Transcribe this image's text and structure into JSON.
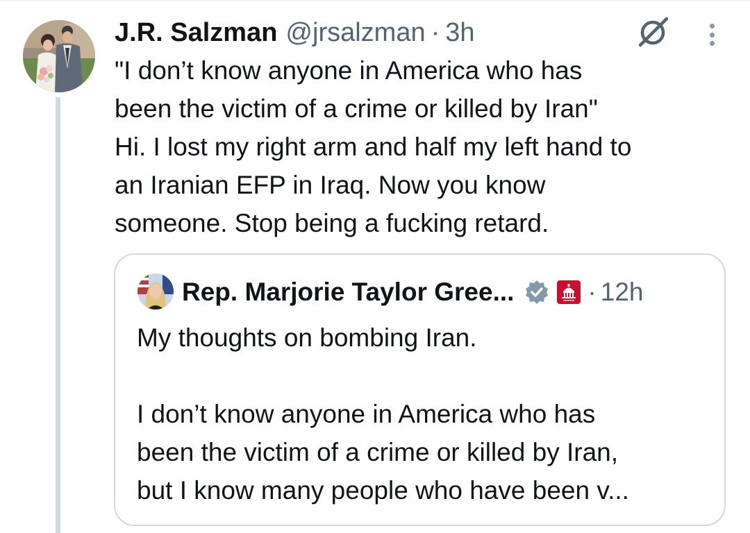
{
  "tweet": {
    "display_name": "J.R. Salzman",
    "handle": "@jrsalzman",
    "separator": "·",
    "time": "3h",
    "text_lines": [
      "\"I don’t know anyone in America who has",
      "been the victim of a crime or killed by Iran\"",
      "Hi. I lost my right arm and half my left hand to",
      "an Iranian EFP in Iraq. Now you know",
      "someone. Stop being a fucking retard."
    ]
  },
  "quote": {
    "display_name": "Rep. Marjorie Taylor Gree...",
    "separator": "·",
    "time": "12h",
    "text_lines": [
      "My thoughts on bombing Iran.",
      "",
      "I don’t know anyone in America who has",
      "been the victim of a crime or killed by Iran,",
      "but I know many people who have been v..."
    ]
  },
  "icons": {
    "grok": "grok-icon",
    "more": "more-options-icon",
    "verified": "verified-badge-icon",
    "affiliation": "us-capitol-badge-icon"
  },
  "colors": {
    "text_primary": "#0f1419",
    "text_secondary": "#536471",
    "border": "#cfd9de",
    "verified": "#829aab",
    "affiliation_badge": "#c8102e"
  }
}
